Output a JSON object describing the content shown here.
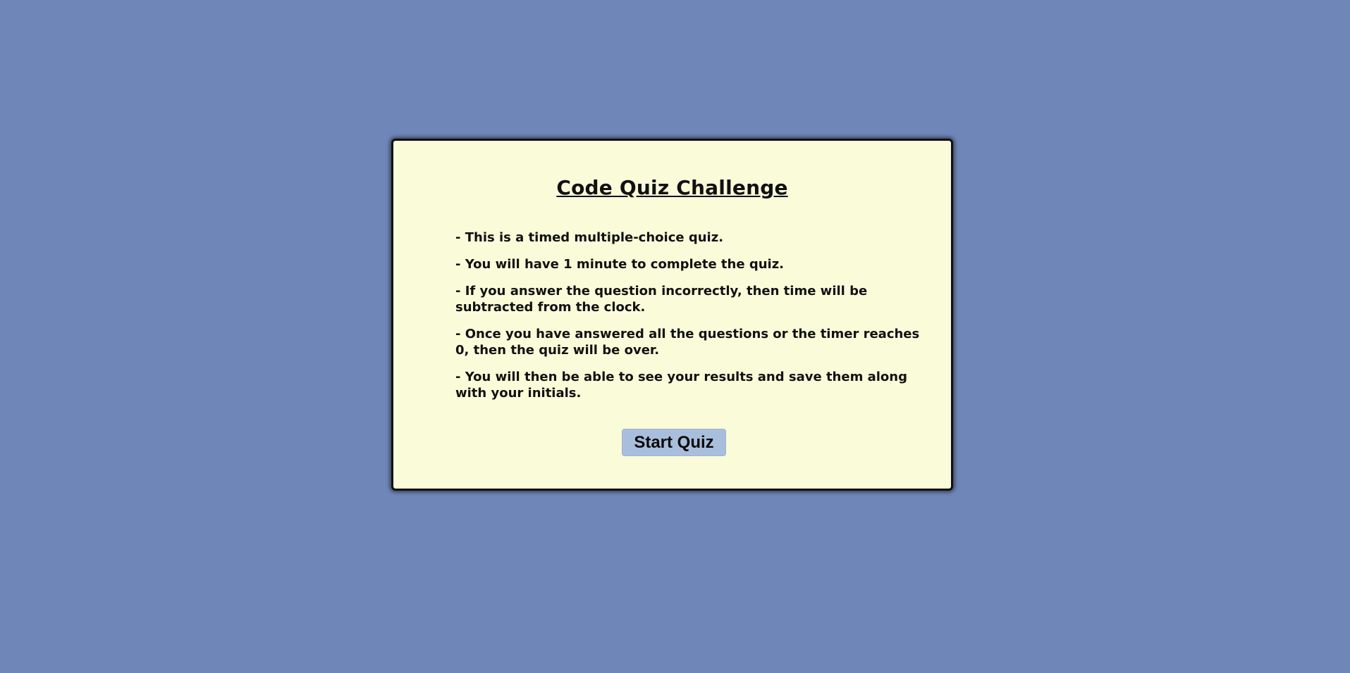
{
  "quiz": {
    "title": "Code Quiz Challenge",
    "rules": [
      "- This is a timed multiple-choice quiz.",
      "- You will have 1 minute to complete the quiz.",
      "- If you answer the question incorrectly, then time will be subtracted from the clock.",
      "- Once you have answered all the questions or the timer reaches 0, then the quiz will be over.",
      "- You will then be able to see your results and save them along with your initials."
    ],
    "start_label": "Start Quiz"
  },
  "colors": {
    "page_background": "#6f86b8",
    "card_background": "#fafbd9",
    "button_background": "#a9bedc",
    "text": "#111111"
  }
}
